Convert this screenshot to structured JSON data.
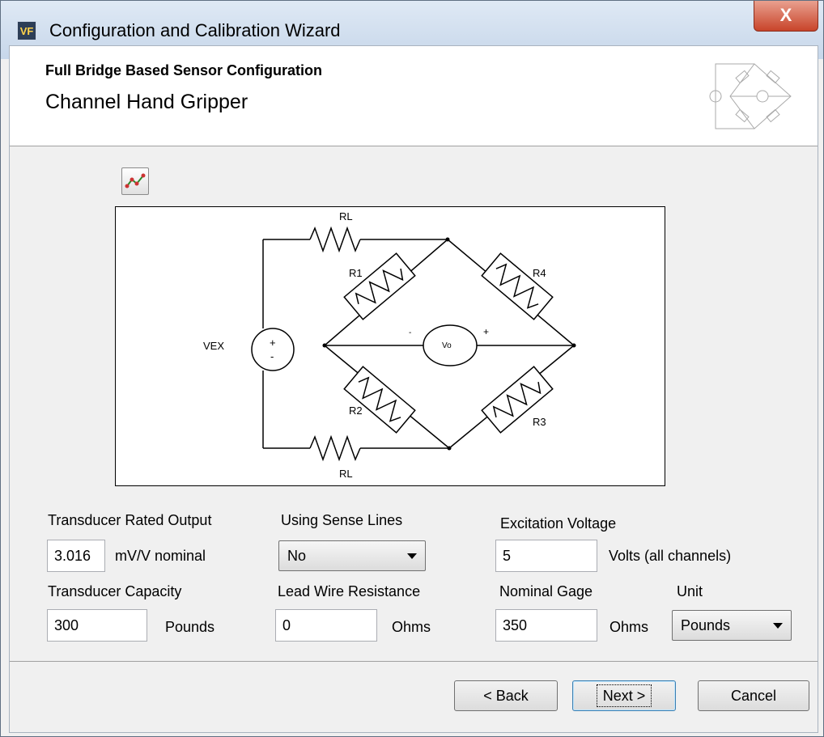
{
  "window": {
    "title": "Configuration and Calibration Wizard",
    "app_icon_text": "VF",
    "close_label": "X"
  },
  "header": {
    "title": "Full Bridge Based Sensor Configuration",
    "subtitle": "Channel Hand Gripper"
  },
  "diagram": {
    "rl_top": "RL",
    "rl_bottom": "RL",
    "r1": "R1",
    "r2": "R2",
    "r3": "R3",
    "r4": "R4",
    "vex": "VEX",
    "vo": "Vo",
    "plus": "+",
    "minus": "-"
  },
  "form": {
    "rated_output_label": "Transducer Rated Output",
    "rated_output_value": "3.016",
    "rated_output_unit": "mV/V nominal",
    "sense_lines_label": "Using Sense Lines",
    "sense_lines_value": "No",
    "excitation_label": "Excitation Voltage",
    "excitation_value": "5",
    "excitation_unit": "Volts (all channels)",
    "capacity_label": "Transducer Capacity",
    "capacity_value": "300",
    "capacity_unit": "Pounds",
    "lead_wire_label": "Lead Wire Resistance",
    "lead_wire_value": "0",
    "lead_wire_unit": "Ohms",
    "nominal_gage_label": "Nominal Gage",
    "nominal_gage_value": "350",
    "nominal_gage_unit": "Ohms",
    "unit_label": "Unit",
    "unit_value": "Pounds"
  },
  "buttons": {
    "back": "< Back",
    "next": "Next >",
    "cancel": "Cancel"
  },
  "colors": {
    "close_red": "#c8442a",
    "titlebar": "#dfe9f5"
  }
}
